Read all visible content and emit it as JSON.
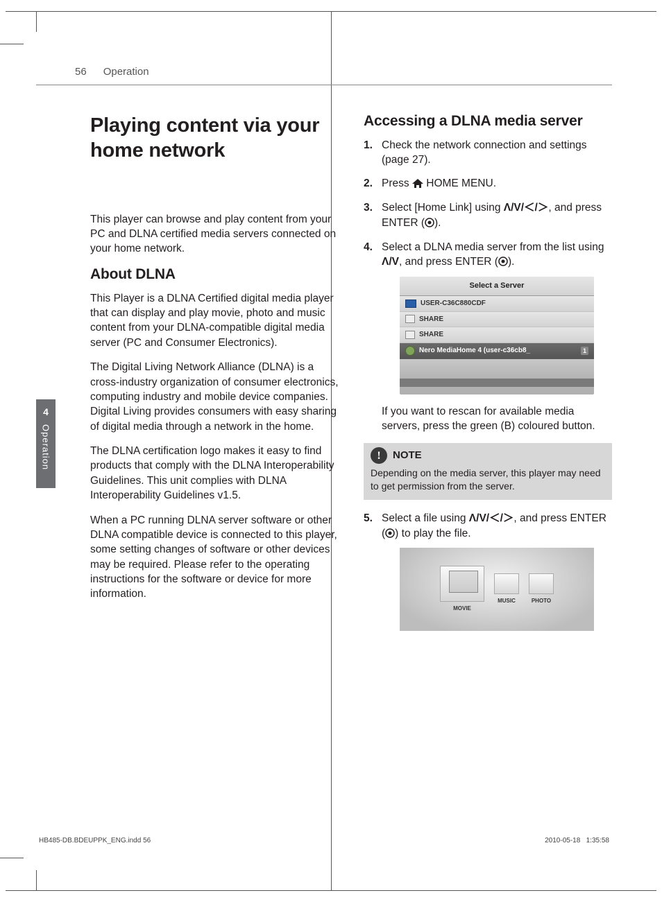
{
  "header": {
    "page_number": "56",
    "section": "Operation"
  },
  "side_tab": {
    "number": "4",
    "label": "Operation"
  },
  "left": {
    "h1": "Playing content via your home network",
    "intro": " This player can browse and play content from your PC and DLNA certified media servers connected on your home network.",
    "h2": "About DLNA",
    "p1": "This Player is a DLNA Certified digital media player that can display and play movie, photo and music content from your DLNA-compatible digital media server (PC and Consumer Electronics).",
    "p2": "The Digital Living Network Alliance (DLNA) is a cross-industry organization of consumer electronics, computing industry and mobile device companies. Digital Living provides consumers with easy sharing of digital media through a network in the home.",
    "p3": "The DLNA certification logo makes it easy to find products that comply with the DLNA Interoperability Guidelines. This unit complies with DLNA Interoperability Guidelines v1.5.",
    "p4": "When a PC running DLNA server software or other DLNA compatible device is connected to this player, some setting changes of software or other devices may be required. Please refer to the operating instructions for the software or device for more information."
  },
  "right": {
    "h2": "Accessing a DLNA media server",
    "steps": {
      "s1": "Check the network connection and settings (page 27).",
      "s2a": "Press ",
      "s2b": " HOME MENU.",
      "s3a": "Select [Home Link] using ",
      "s3b": ", and press ENTER (",
      "s3c": ").",
      "s4a": "Select a DLNA media server from the list using ",
      "s4b": ", and press ENTER (",
      "s4c": ").",
      "after4": "If you want to rescan for available media servers, press the green (B) coloured button.",
      "s5a": "Select a file using ",
      "s5b": ", and press ENTER (",
      "s5c": ") to play the file."
    },
    "shot1": {
      "title": "Select a Server",
      "row1": "USER-C36C880CDF",
      "row2": "SHARE",
      "row3": "SHARE",
      "row4": "Nero MediaHome 4 (user-c36cb8_",
      "row4_num": "1"
    },
    "shot2": {
      "movie": "MOVIE",
      "music": "MUSIC",
      "photo": "PHOTO"
    },
    "note": {
      "label": "NOTE",
      "text": "Depending on the media server, this player may need to get permission from the server."
    }
  },
  "footer": {
    "file": "HB485-DB.BDEUPPK_ENG.indd   56",
    "date": "2010-05-18",
    "time": "1:35:58"
  },
  "glyphs": {
    "nav4": "Λ/V/＜/＞",
    "nav2": "Λ/V"
  }
}
